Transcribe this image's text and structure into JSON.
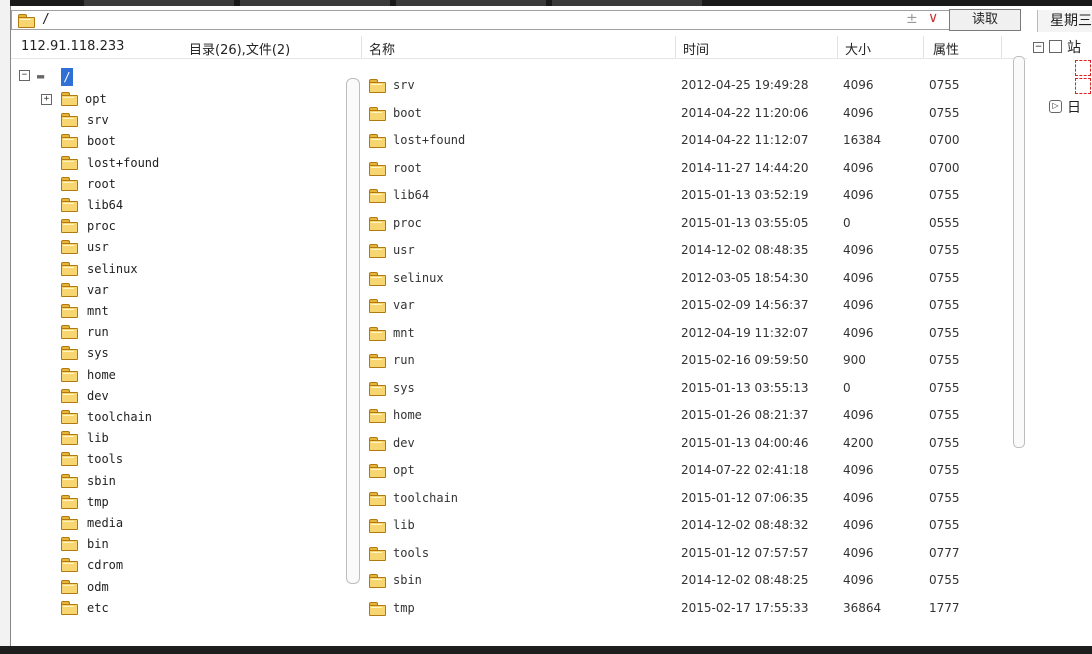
{
  "pathbar": {
    "path": "/",
    "plus_minus": "±",
    "dropdown": "∨",
    "read_label": "读取"
  },
  "day_header": "星期三",
  "header": {
    "ip": "112.91.118.233",
    "summary": "目录(26),文件(2)",
    "col_name": "名称",
    "col_time": "时间",
    "col_size": "大小",
    "col_attr": "属性"
  },
  "tree": {
    "root_label": "/",
    "items": [
      "opt",
      "srv",
      "boot",
      "lost+found",
      "root",
      "lib64",
      "proc",
      "usr",
      "selinux",
      "var",
      "mnt",
      "run",
      "sys",
      "home",
      "dev",
      "toolchain",
      "lib",
      "tools",
      "sbin",
      "tmp",
      "media",
      "bin",
      "cdrom",
      "odm",
      "etc"
    ]
  },
  "files": [
    {
      "name": "srv",
      "time": "2012-04-25 19:49:28",
      "size": "4096",
      "attr": "0755"
    },
    {
      "name": "boot",
      "time": "2014-04-22 11:20:06",
      "size": "4096",
      "attr": "0755"
    },
    {
      "name": "lost+found",
      "time": "2014-04-22 11:12:07",
      "size": "16384",
      "attr": "0700"
    },
    {
      "name": "root",
      "time": "2014-11-27 14:44:20",
      "size": "4096",
      "attr": "0700"
    },
    {
      "name": "lib64",
      "time": "2015-01-13 03:52:19",
      "size": "4096",
      "attr": "0755"
    },
    {
      "name": "proc",
      "time": "2015-01-13 03:55:05",
      "size": "0",
      "attr": "0555"
    },
    {
      "name": "usr",
      "time": "2014-12-02 08:48:35",
      "size": "4096",
      "attr": "0755"
    },
    {
      "name": "selinux",
      "time": "2012-03-05 18:54:30",
      "size": "4096",
      "attr": "0755"
    },
    {
      "name": "var",
      "time": "2015-02-09 14:56:37",
      "size": "4096",
      "attr": "0755"
    },
    {
      "name": "mnt",
      "time": "2012-04-19 11:32:07",
      "size": "4096",
      "attr": "0755"
    },
    {
      "name": "run",
      "time": "2015-02-16 09:59:50",
      "size": "900",
      "attr": "0755"
    },
    {
      "name": "sys",
      "time": "2015-01-13 03:55:13",
      "size": "0",
      "attr": "0755"
    },
    {
      "name": "home",
      "time": "2015-01-26 08:21:37",
      "size": "4096",
      "attr": "0755"
    },
    {
      "name": "dev",
      "time": "2015-01-13 04:00:46",
      "size": "4200",
      "attr": "0755"
    },
    {
      "name": "opt",
      "time": "2014-07-22 02:41:18",
      "size": "4096",
      "attr": "0755"
    },
    {
      "name": "toolchain",
      "time": "2015-01-12 07:06:35",
      "size": "4096",
      "attr": "0755"
    },
    {
      "name": "lib",
      "time": "2014-12-02 08:48:32",
      "size": "4096",
      "attr": "0755"
    },
    {
      "name": "tools",
      "time": "2015-01-12 07:57:57",
      "size": "4096",
      "attr": "0777"
    },
    {
      "name": "sbin",
      "time": "2014-12-02 08:48:25",
      "size": "4096",
      "attr": "0755"
    },
    {
      "name": "tmp",
      "time": "2015-02-17 17:55:33",
      "size": "36864",
      "attr": "1777"
    }
  ],
  "right_pane": {
    "site_label": "站",
    "day_label": "日"
  }
}
